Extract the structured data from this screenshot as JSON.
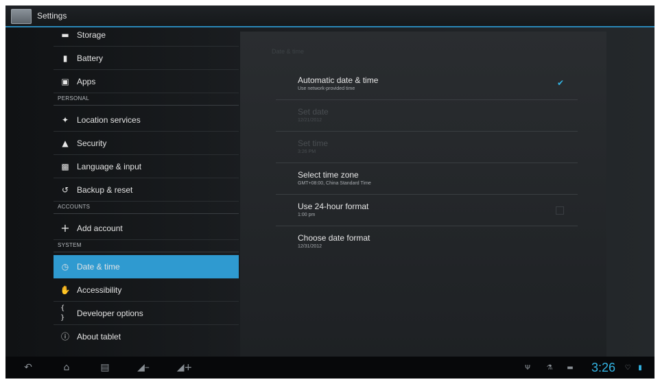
{
  "actionbar": {
    "title": "Settings",
    "app_icon": "settings-app-icon"
  },
  "sidebar": {
    "items": [
      {
        "label": "Storage",
        "icon": "storage-icon"
      },
      {
        "label": "Battery",
        "icon": "battery-icon"
      },
      {
        "label": "Apps",
        "icon": "apps-icon"
      },
      {
        "label": "Location services",
        "icon": "location-icon"
      },
      {
        "label": "Security",
        "icon": "lock-icon"
      },
      {
        "label": "Language & input",
        "icon": "language-icon"
      },
      {
        "label": "Backup & reset",
        "icon": "backup-icon"
      },
      {
        "label": "Add account",
        "icon": "plus-icon"
      },
      {
        "label": "Date & time",
        "icon": "clock-icon",
        "selected": true
      },
      {
        "label": "Accessibility",
        "icon": "accessibility-icon"
      },
      {
        "label": "Developer options",
        "icon": "braces-icon"
      },
      {
        "label": "About tablet",
        "icon": "info-icon"
      }
    ],
    "sections": {
      "personal": "PERSONAL",
      "accounts": "ACCOUNTS",
      "system": "SYSTEM"
    }
  },
  "main": {
    "heading": "Date & time",
    "settings": [
      {
        "title": "Automatic date & time",
        "summary": "Use network-provided time",
        "checked": true,
        "enabled": true
      },
      {
        "title": "Set date",
        "summary": "12/21/2012",
        "enabled": false
      },
      {
        "title": "Set time",
        "summary": "3:26 PM",
        "enabled": false
      },
      {
        "title": "Select time zone",
        "summary": "GMT+08:00, China Standard Time",
        "enabled": true
      },
      {
        "title": "Use 24-hour format",
        "summary": "1:00 pm",
        "checked": false,
        "enabled": true
      },
      {
        "title": "Choose date format",
        "summary": "12/31/2012",
        "enabled": true
      }
    ]
  },
  "navbar": {
    "clock": "3:26",
    "buttons": [
      "back-icon",
      "home-icon",
      "recent-apps-icon",
      "volume-down-icon",
      "volume-up-icon"
    ],
    "status_icons": [
      "usb-icon",
      "usb-debug-icon",
      "sd-card-icon",
      "wifi-icon",
      "battery-status-icon"
    ]
  },
  "colors": {
    "accent": "#33b5e5",
    "selected_bg": "#2f9ad0"
  }
}
